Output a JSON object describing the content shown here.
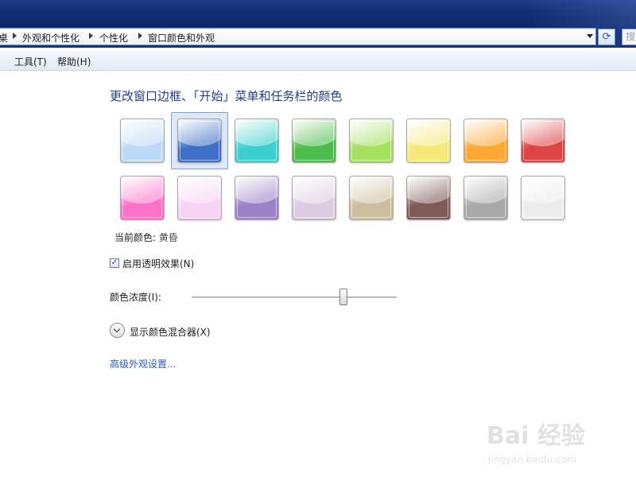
{
  "breadcrumb": {
    "root": "桌",
    "items": [
      "外观和个性化",
      "个性化",
      "窗口颜色和外观"
    ]
  },
  "search": {
    "placeholder": "搜"
  },
  "menu": {
    "items": [
      "工具(T)",
      "帮助(H)"
    ]
  },
  "heading": "更改窗口边框、「开始」菜单和任务栏的颜色",
  "swatches": [
    {
      "name": "sky",
      "color": "#bcd9f7"
    },
    {
      "name": "twilight",
      "color": "#3f6fc7"
    },
    {
      "name": "sea",
      "color": "#3ccfcf"
    },
    {
      "name": "leaf",
      "color": "#4cbc4c"
    },
    {
      "name": "lime",
      "color": "#a6e060"
    },
    {
      "name": "pumpkin-light",
      "color": "#f6e97a"
    },
    {
      "name": "pumpkin",
      "color": "#ffa733"
    },
    {
      "name": "ruby",
      "color": "#de4444"
    },
    {
      "name": "fuchsia",
      "color": "#ff70c8"
    },
    {
      "name": "blush",
      "color": "#f7d2f3"
    },
    {
      "name": "violet",
      "color": "#9c80c8"
    },
    {
      "name": "lavender",
      "color": "#dccbe1"
    },
    {
      "name": "taupe",
      "color": "#cdbf9e"
    },
    {
      "name": "chocolate",
      "color": "#7f5b58"
    },
    {
      "name": "slate",
      "color": "#a9a9a9"
    },
    {
      "name": "frost",
      "color": "#ececec"
    }
  ],
  "selected_swatch_index": 1,
  "current_color": {
    "label": "当前颜色:",
    "value": "黄昏"
  },
  "transparency": {
    "label": "启用透明效果(N)",
    "checked": true
  },
  "intensity": {
    "label": "颜色浓度(I):",
    "value_percent": 74
  },
  "mixer": {
    "label": "显示颜色混合器(X)"
  },
  "advanced_link": "高级外观设置...",
  "watermark": {
    "text": "Bai 经验",
    "sub": "jingyan.baidu.com"
  }
}
